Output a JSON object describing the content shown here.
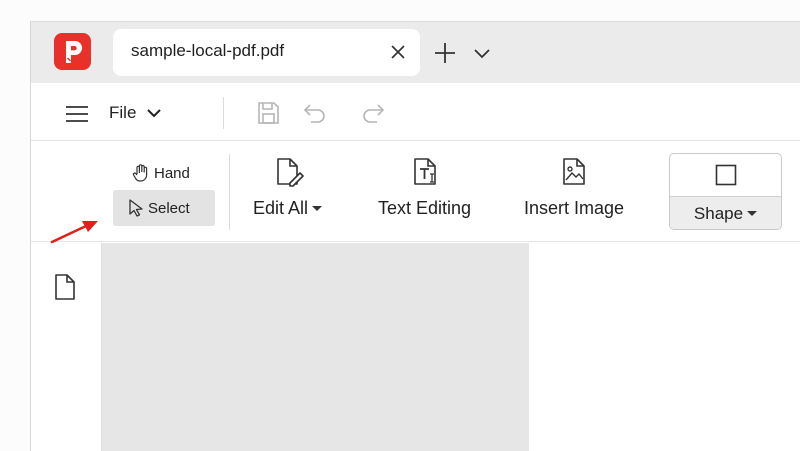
{
  "tab": {
    "title": "sample-local-pdf.pdf"
  },
  "menu": {
    "file_label": "File"
  },
  "ribbon": {
    "hand_label": "Hand",
    "select_label": "Select",
    "edit_all_label": "Edit All",
    "text_editing_label": "Text Editing",
    "insert_image_label": "Insert Image",
    "shape_label": "Shape"
  },
  "colors": {
    "brand": "#e8312b",
    "annotation_arrow": "#e0201a",
    "active_tool_bg": "#e3e3e3",
    "page_bg": "#e6e6e6"
  },
  "icons": [
    "app-logo-icon",
    "close-icon",
    "plus-icon",
    "chevron-down-icon",
    "hamburger-icon",
    "save-icon",
    "undo-icon",
    "redo-icon",
    "hand-icon",
    "cursor-icon",
    "edit-document-icon",
    "text-edit-icon",
    "insert-image-icon",
    "square-icon",
    "document-icon"
  ]
}
